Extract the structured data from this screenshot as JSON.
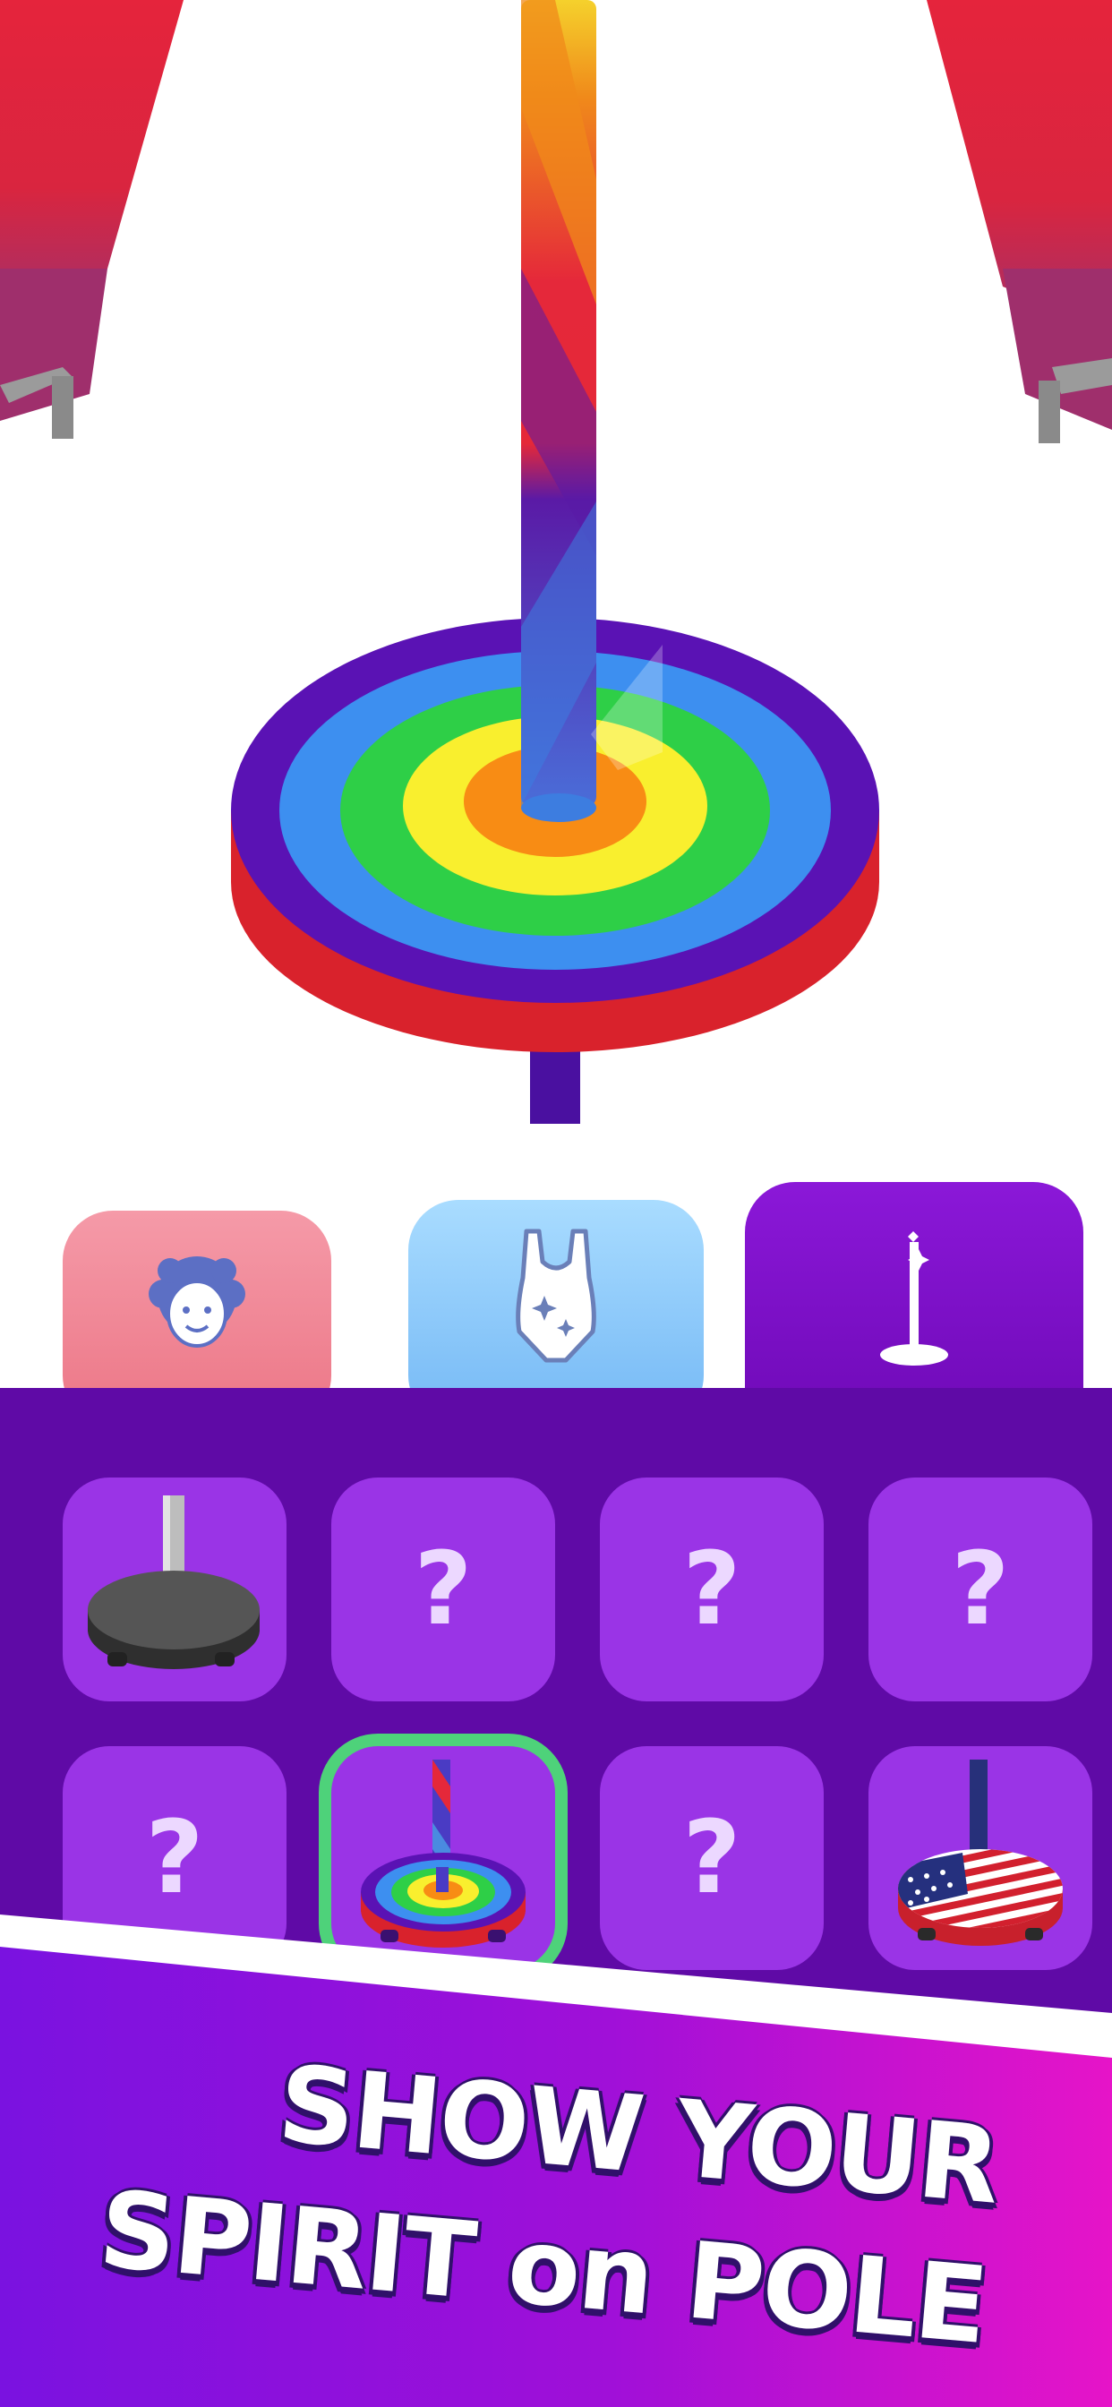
{
  "tabs": [
    {
      "id": "hair",
      "icon": "curly-hair-face-icon",
      "selected": false
    },
    {
      "id": "outfit",
      "icon": "leotard-icon",
      "selected": false
    },
    {
      "id": "pole",
      "icon": "pole-stand-icon",
      "selected": true
    }
  ],
  "grid": {
    "items": [
      {
        "type": "grey-pole",
        "locked": false,
        "label": ""
      },
      {
        "type": "locked",
        "locked": true,
        "label": "?"
      },
      {
        "type": "locked",
        "locked": true,
        "label": "?"
      },
      {
        "type": "locked",
        "locked": true,
        "label": "?"
      },
      {
        "type": "locked",
        "locked": true,
        "label": "?"
      },
      {
        "type": "rainbow-pole",
        "locked": false,
        "selected": true,
        "label": ""
      },
      {
        "type": "locked",
        "locked": true,
        "label": "?"
      },
      {
        "type": "usa-flag-pole",
        "locked": false,
        "label": ""
      }
    ]
  },
  "banner": {
    "line1": "SHOW YOUR",
    "line2": "SPIRIT on POLE"
  },
  "colors": {
    "panel": "#5f0aa6",
    "cell": "#9a34e6",
    "selected_outline": "#4ed27a",
    "curtain": "#e0233c"
  }
}
